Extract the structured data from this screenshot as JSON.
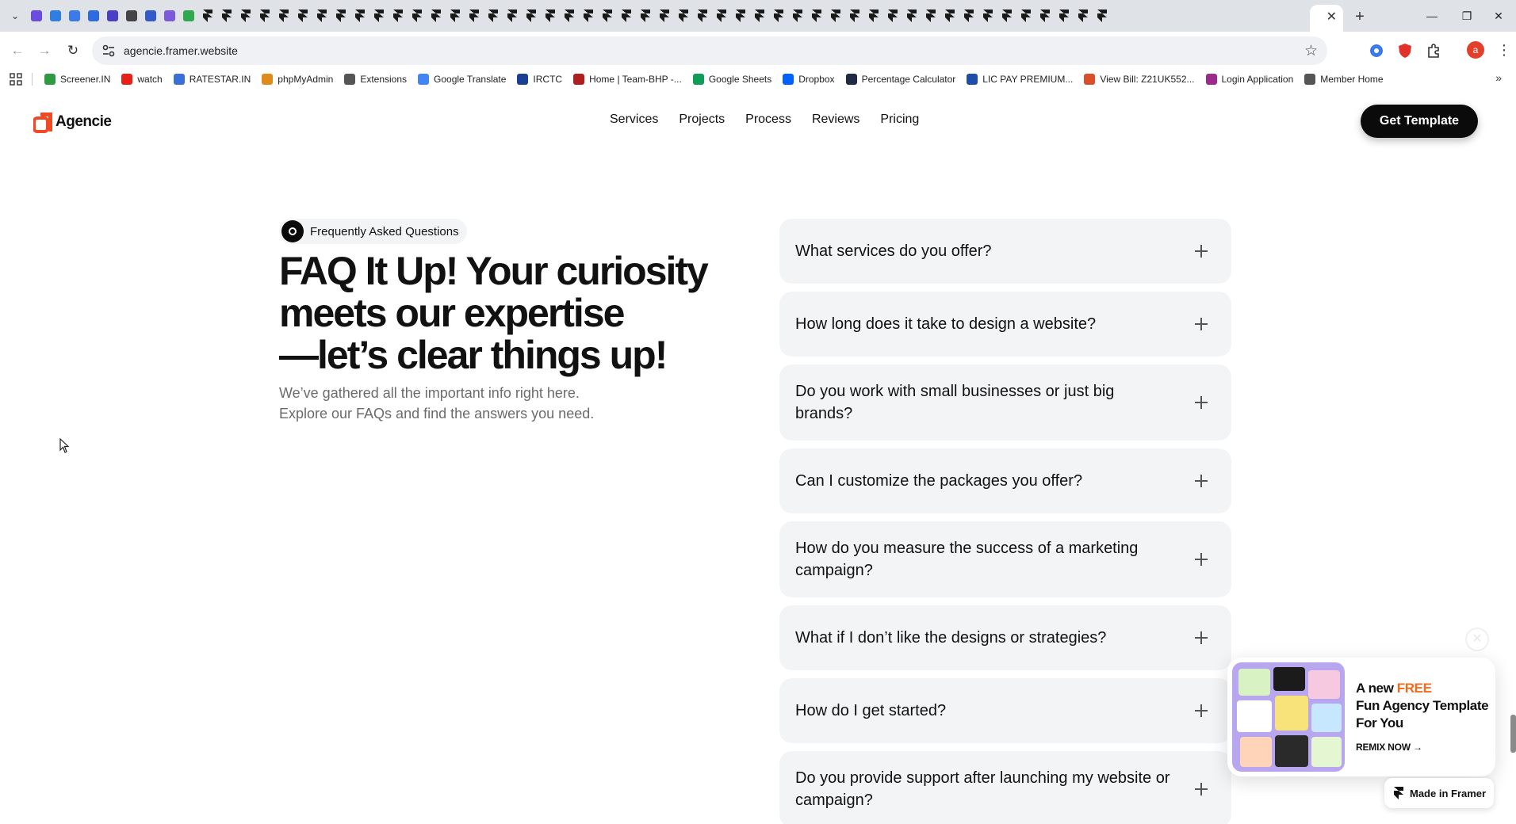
{
  "browser": {
    "tab_favicon_colors": [
      "#6a4ce0",
      "#2f7fe2",
      "#3b7be9",
      "#2d6cdf",
      "#4a3fc4",
      "#444444",
      "#3659c9",
      "#7d5ad8",
      "#2fa84f"
    ],
    "framer_tab_count": 48,
    "close_tab_glyph": "✕",
    "new_tab_glyph": "+",
    "window_minimize": "—",
    "window_restore": "❐",
    "window_close": "✕",
    "url": "agencie.framer.website",
    "profile_initial": "a",
    "bookmarks": [
      {
        "label": "Screener.IN",
        "color": "#2e9b42"
      },
      {
        "label": "watch",
        "color": "#e62117"
      },
      {
        "label": "RATESTAR.IN",
        "color": "#3a6fd8"
      },
      {
        "label": "phpMyAdmin",
        "color": "#e08a1c"
      },
      {
        "label": "Extensions",
        "color": "#555555"
      },
      {
        "label": "Google Translate",
        "color": "#4285f4"
      },
      {
        "label": "IRCTC",
        "color": "#1c3f94"
      },
      {
        "label": "Home | Team-BHP -...",
        "color": "#b01e1e"
      },
      {
        "label": "Google Sheets",
        "color": "#0f9d58"
      },
      {
        "label": "Dropbox",
        "color": "#0061fe"
      },
      {
        "label": "Percentage Calculator",
        "color": "#1f2a44"
      },
      {
        "label": "LIC PAY PREMIUM...",
        "color": "#1d4fa8"
      },
      {
        "label": "View Bill: Z21UK552...",
        "color": "#d94f2a"
      },
      {
        "label": "Login Application",
        "color": "#9c2b8c"
      },
      {
        "label": "Member Home",
        "color": "#555555"
      }
    ]
  },
  "site": {
    "logo_text": "Agencie",
    "brand_color": "#f04a24",
    "nav": [
      "Services",
      "Projects",
      "Process",
      "Reviews",
      "Pricing"
    ],
    "cta_label": "Get Template"
  },
  "faq": {
    "badge": "Frequently Asked Questions",
    "headline_lines": [
      "FAQ It Up! Your curiosity",
      "meets our expertise",
      "—let’s clear things up!"
    ],
    "subtext_lines": [
      "We’ve gathered all the important info right here.",
      "Explore our FAQs and find the answers you need."
    ],
    "questions": [
      "What services do you offer?",
      "How long does it take to design a website?",
      "Do you work with small businesses or just big brands?",
      "Can I customize the packages you offer?",
      "How do you measure the success of a marketing campaign?",
      "What if I don’t like the designs or strategies?",
      "How do I get started?",
      "Do you provide support after launching my website or campaign?"
    ]
  },
  "promo": {
    "close_glyph": "✕",
    "title_prefix": "A new ",
    "title_highlight": "FREE",
    "title_rest": "Fun Agency Template For You",
    "remix_label": "REMIX NOW →",
    "highlight_color": "#f26b1d"
  },
  "framer_badge": "Made in Framer"
}
